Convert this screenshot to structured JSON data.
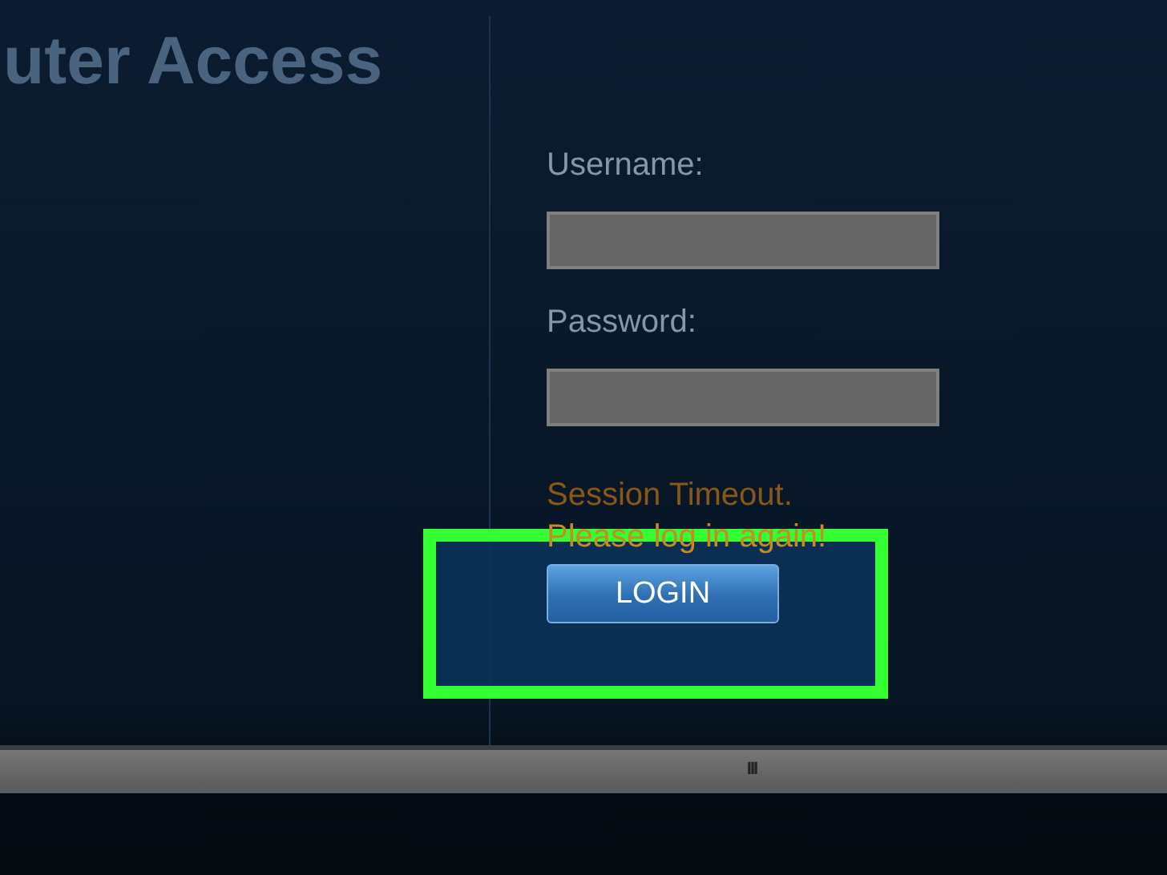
{
  "page_title": "uter Access",
  "form": {
    "fields": [
      {
        "label": "Username:"
      },
      {
        "label": "Password:"
      }
    ],
    "messages": [
      "Session Timeout.",
      "Please log in again!"
    ],
    "button": "LOGIN"
  },
  "highlight": {
    "kind": "frame"
  },
  "scrollbar": {
    "grip": "III"
  }
}
